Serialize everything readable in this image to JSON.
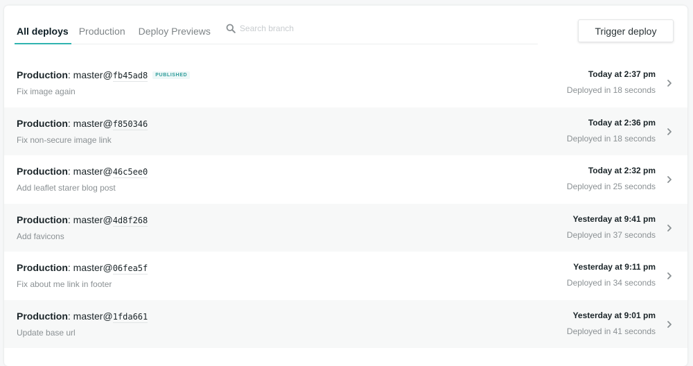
{
  "tabs": [
    {
      "label": "All deploys",
      "active": true
    },
    {
      "label": "Production",
      "active": false
    },
    {
      "label": "Deploy Previews",
      "active": false
    }
  ],
  "search": {
    "placeholder": "Search branch",
    "value": "",
    "icon": "search-icon"
  },
  "trigger_deploy_label": "Trigger deploy",
  "colors": {
    "accent": "#30b3b0",
    "published_badge": "#2d9c99",
    "muted_text": "#8a9093"
  },
  "deploys": [
    {
      "context": "Production",
      "branch": "master",
      "sha": "fb45ad8",
      "badge": "PUBLISHED",
      "message": "Fix image again",
      "time": "Today at 2:37 pm",
      "duration": "Deployed in 18 seconds"
    },
    {
      "context": "Production",
      "branch": "master",
      "sha": "f850346",
      "badge": "",
      "message": "Fix non-secure image link",
      "time": "Today at 2:36 pm",
      "duration": "Deployed in 18 seconds"
    },
    {
      "context": "Production",
      "branch": "master",
      "sha": "46c5ee0",
      "badge": "",
      "message": "Add leaflet starer blog post",
      "time": "Today at 2:32 pm",
      "duration": "Deployed in 25 seconds"
    },
    {
      "context": "Production",
      "branch": "master",
      "sha": "4d8f268",
      "badge": "",
      "message": "Add favicons",
      "time": "Yesterday at 9:41 pm",
      "duration": "Deployed in 37 seconds"
    },
    {
      "context": "Production",
      "branch": "master",
      "sha": "06fea5f",
      "badge": "",
      "message": "Fix about me link in footer",
      "time": "Yesterday at 9:11 pm",
      "duration": "Deployed in 34 seconds"
    },
    {
      "context": "Production",
      "branch": "master",
      "sha": "1fda661",
      "badge": "",
      "message": "Update base url",
      "time": "Yesterday at 9:01 pm",
      "duration": "Deployed in 41 seconds"
    }
  ]
}
